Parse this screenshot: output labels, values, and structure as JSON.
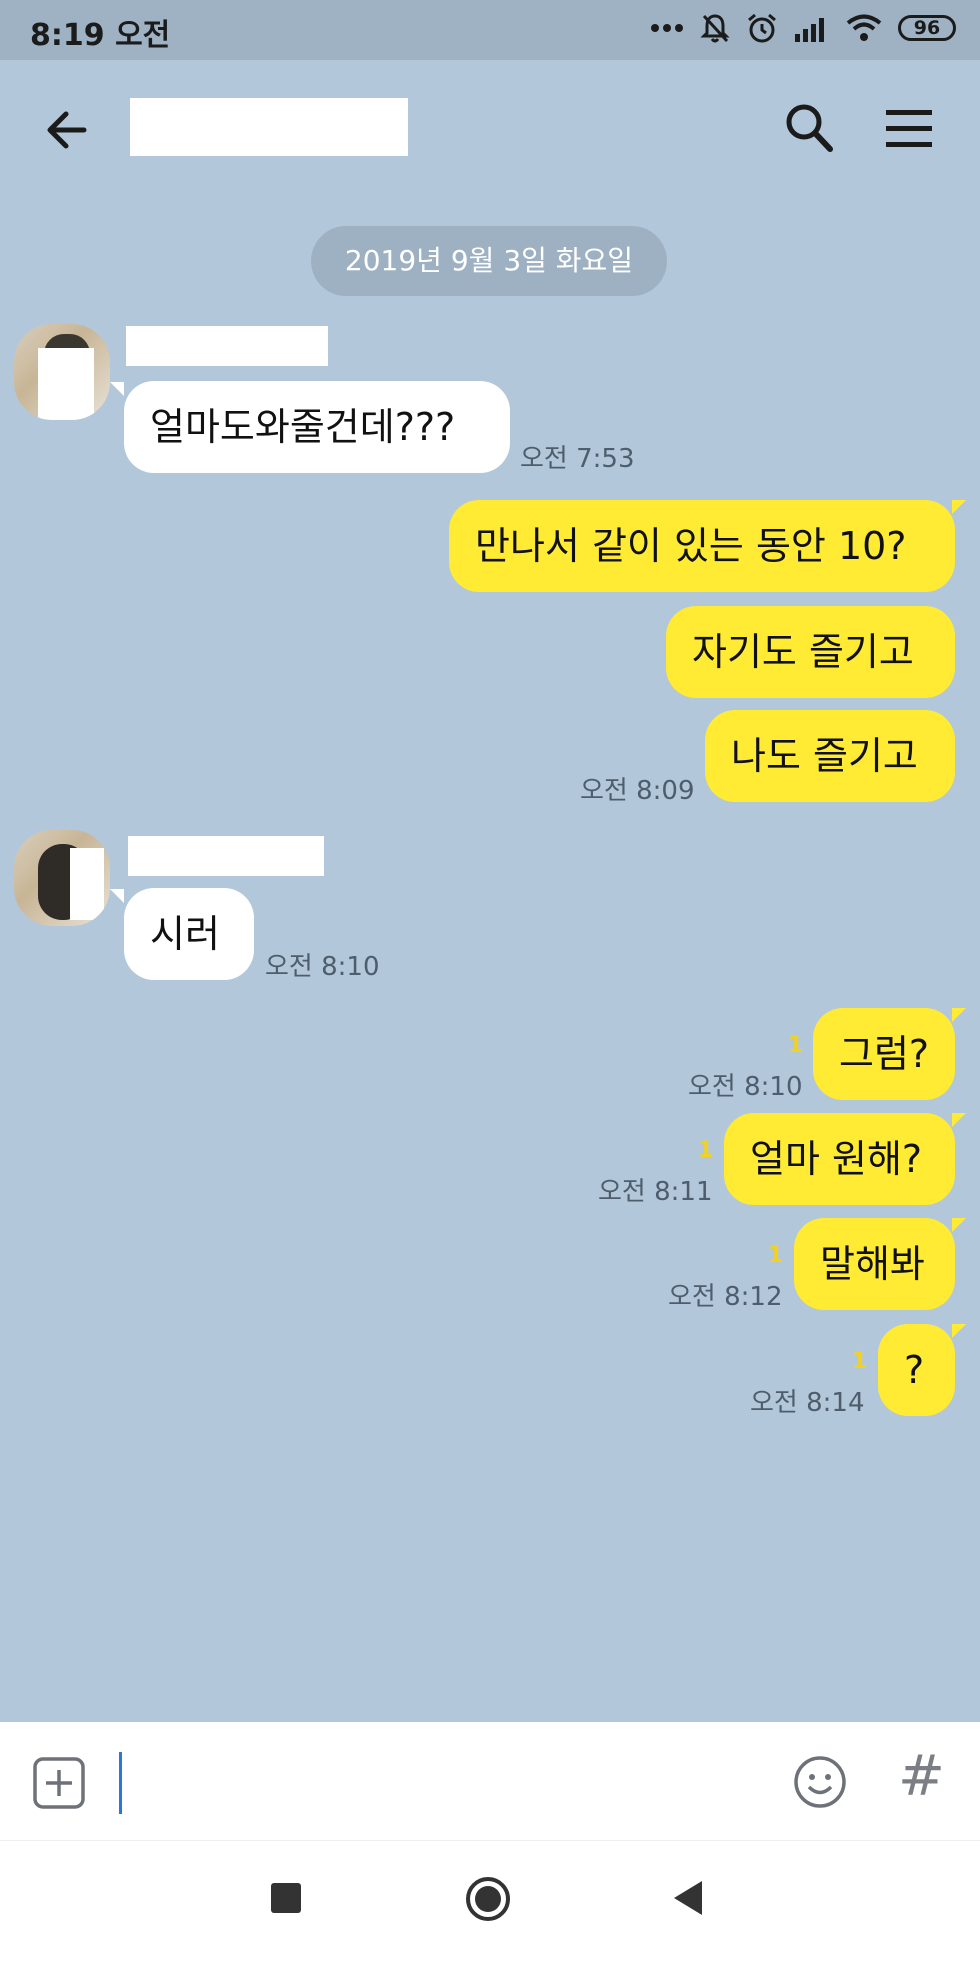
{
  "status_bar": {
    "time": "8:19 오전",
    "battery": "96"
  },
  "header": {
    "search_icon": "search-icon",
    "menu_icon": "menu-icon",
    "back_icon": "back-arrow-icon"
  },
  "date_divider": "2019년 9월 3일 화요일",
  "messages": [
    {
      "id": "m1",
      "dir": "in",
      "text": "얼마도와줄건데???",
      "time": "오전 7:53"
    },
    {
      "id": "m2",
      "dir": "out",
      "text": "만나서 같이 있는 동안 10?",
      "time": ""
    },
    {
      "id": "m3",
      "dir": "out",
      "text": "자기도 즐기고",
      "time": ""
    },
    {
      "id": "m4",
      "dir": "out",
      "text": "나도 즐기고",
      "time": "오전 8:09"
    },
    {
      "id": "m5",
      "dir": "in",
      "text": "시러",
      "time": "오전 8:10"
    },
    {
      "id": "m6",
      "dir": "out",
      "text": "그럼?",
      "time": "오전 8:10",
      "unread": "1"
    },
    {
      "id": "m7",
      "dir": "out",
      "text": "얼마 원해?",
      "time": "오전 8:11",
      "unread": "1"
    },
    {
      "id": "m8",
      "dir": "out",
      "text": "말해봐",
      "time": "오전 8:12",
      "unread": "1"
    },
    {
      "id": "m9",
      "dir": "out",
      "text": "?",
      "time": "오전 8:14",
      "unread": "1"
    }
  ],
  "input_bar": {
    "hash_label": "#",
    "plus_icon": "plus-box-icon",
    "emoji_icon": "emoji-icon"
  },
  "colors": {
    "background": "#b2c7da",
    "my_bubble": "#ffeb33",
    "their_bubble": "#ffffff",
    "unread_badge": "#f2d21f"
  }
}
